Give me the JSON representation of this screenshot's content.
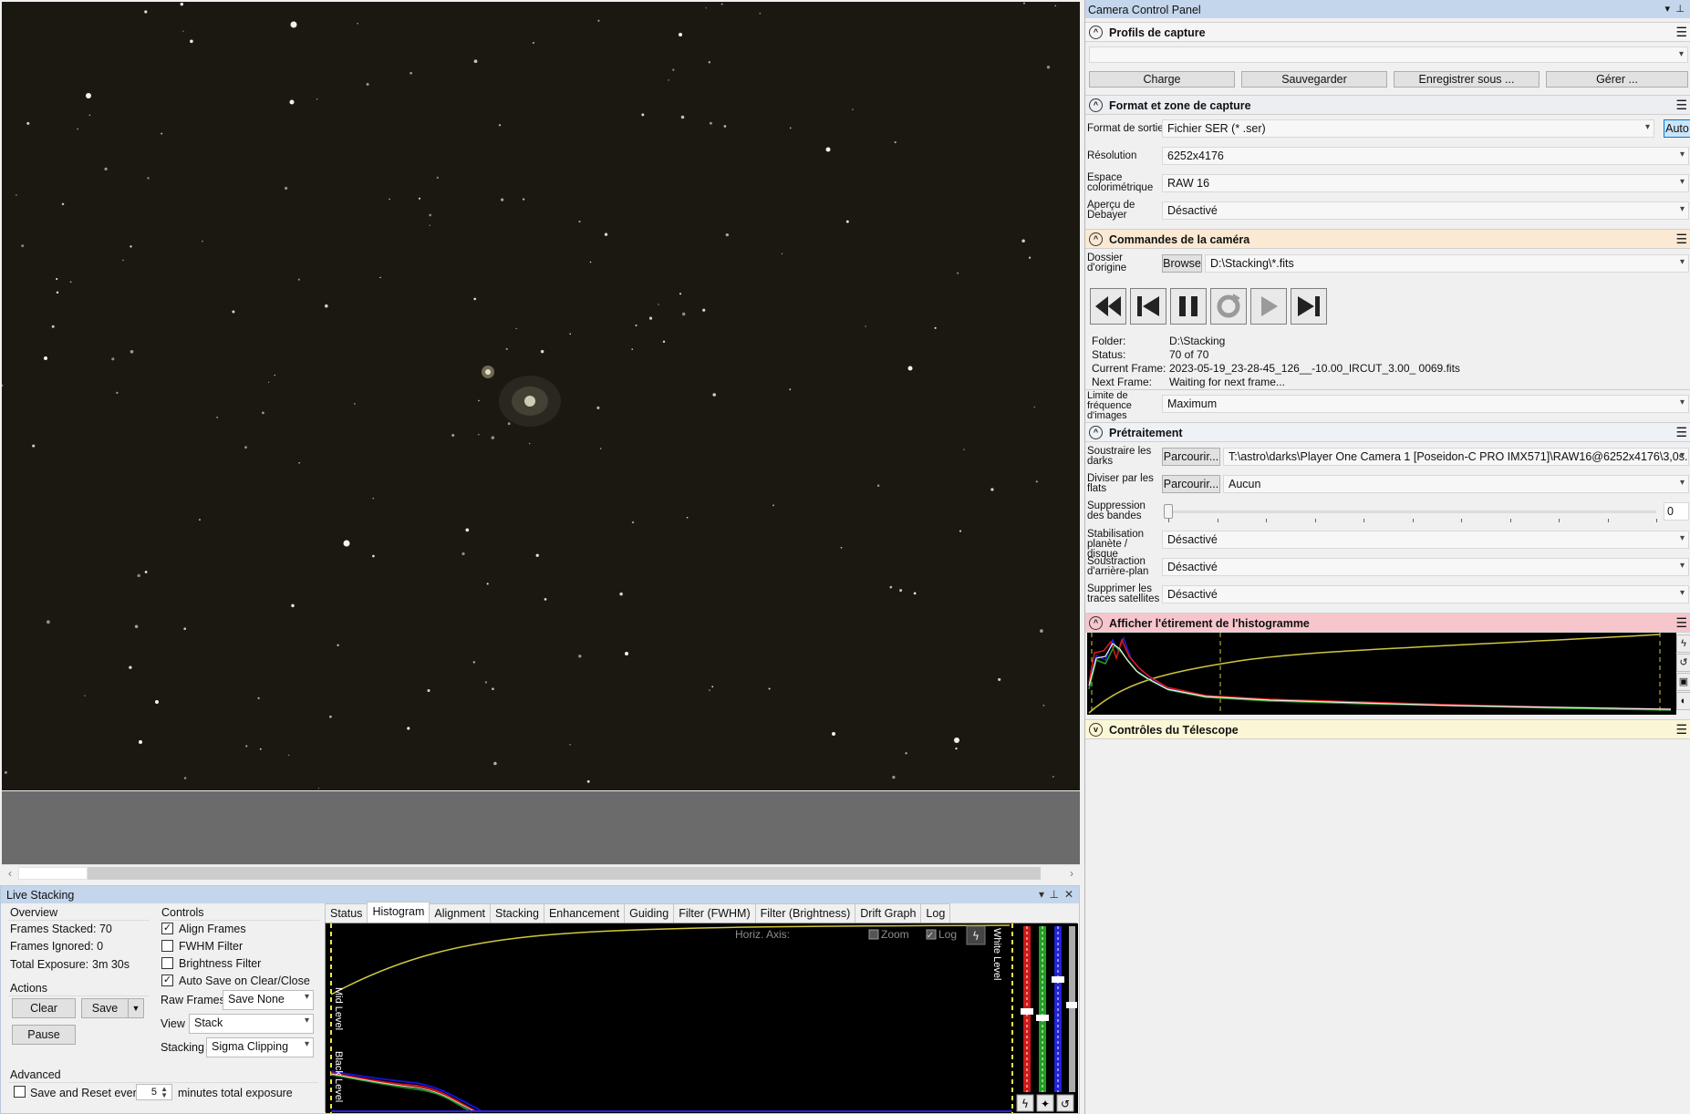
{
  "live_stacking": {
    "title": "Live Stacking",
    "overview": {
      "heading": "Overview",
      "frames_stacked": "Frames Stacked: 70",
      "frames_ignored": "Frames Ignored: 0",
      "total_exposure_label": "Total Exposure:",
      "total_exposure_value": "3m 30s"
    },
    "actions": {
      "heading": "Actions",
      "clear": "Clear",
      "save": "Save",
      "pause": "Pause"
    },
    "controls": {
      "heading": "Controls",
      "align_frames": "Align Frames",
      "fwhm_filter": "FWHM Filter",
      "brightness_filter": "Brightness Filter",
      "auto_save": "Auto Save on Clear/Close",
      "raw_frames_label": "Raw Frames",
      "raw_frames_value": "Save None",
      "view_label": "View",
      "view_value": "Stack",
      "stacking_label": "Stacking",
      "stacking_value": "Sigma Clipping"
    },
    "advanced": {
      "heading": "Advanced",
      "save_reset_label": "Save and Reset every",
      "save_reset_value": "5",
      "minutes_label": "minutes total exposure"
    },
    "tabs": [
      "Status",
      "Histogram",
      "Alignment",
      "Stacking",
      "Enhancement",
      "Guiding",
      "Filter (FWHM)",
      "Filter (Brightness)",
      "Drift Graph",
      "Log"
    ],
    "active_tab": "Histogram",
    "histogram": {
      "horiz_axis": "Horiz. Axis:",
      "zoom": "Zoom",
      "log": "Log",
      "mid_level": "Mid Level",
      "white_level": "White Level",
      "black_level": "Black Level"
    }
  },
  "camera_panel": {
    "title": "Camera Control Panel",
    "profils": {
      "heading": "Profils de capture",
      "charge": "Charge",
      "sauvegarder": "Sauvegarder",
      "enregistrer": "Enregistrer sous ...",
      "gerer": "Gérer ..."
    },
    "format": {
      "heading": "Format et zone de capture",
      "format_sortie_label": "Format de sortie",
      "format_sortie_value": "Fichier SER (* .ser)",
      "auto": "Auto",
      "resolution_label": "Résolution",
      "resolution_value": "6252x4176",
      "espace_label": "Espace colorimétrique",
      "espace_value": "RAW 16",
      "apercu_label": "Aperçu de Debayer",
      "apercu_value": "Désactivé"
    },
    "commandes": {
      "heading": "Commandes de la caméra",
      "dossier_label": "Dossier d'origine",
      "browse": "Browse",
      "dossier_value": "D:\\Stacking\\*.fits",
      "folder_label": "Folder:",
      "folder_value": "D:\\Stacking",
      "status_label": "Status:",
      "status_value": "70 of 70",
      "current_label": "Current Frame:",
      "current_value": "2023-05-19_23-28-45_126__-10.00_IRCUT_3.00_ 0069.fits",
      "next_label": "Next Frame:",
      "next_value": "Waiting for next frame...",
      "limite_label": "Limite de fréquence d'images",
      "limite_value": "Maximum"
    },
    "pretraitement": {
      "heading": "Prétraitement",
      "darks_label": "Soustraire les darks",
      "parcourir": "Parcourir...",
      "darks_value": "T:\\astro\\darks\\Player One Camera 1 [Poseidon-C PRO IMX571]\\RAW16@6252x4176\\3,0s...",
      "flats_label": "Diviser par les flats",
      "flats_value": "Aucun",
      "bandes_label": "Suppression des bandes",
      "bandes_value": "0",
      "stabil_label": "Stabilisation planète / disque",
      "stabil_value": "Désactivé",
      "soustraction_label": "Soustraction d'arrière-plan",
      "soustraction_value": "Désactivé",
      "satellites_label": "Supprimer les traces satellites",
      "satellites_value": "Désactivé"
    },
    "histo_heading": "Afficher l'étirement de l'histogramme",
    "telescope_heading": "Contrôles du Télescope"
  }
}
